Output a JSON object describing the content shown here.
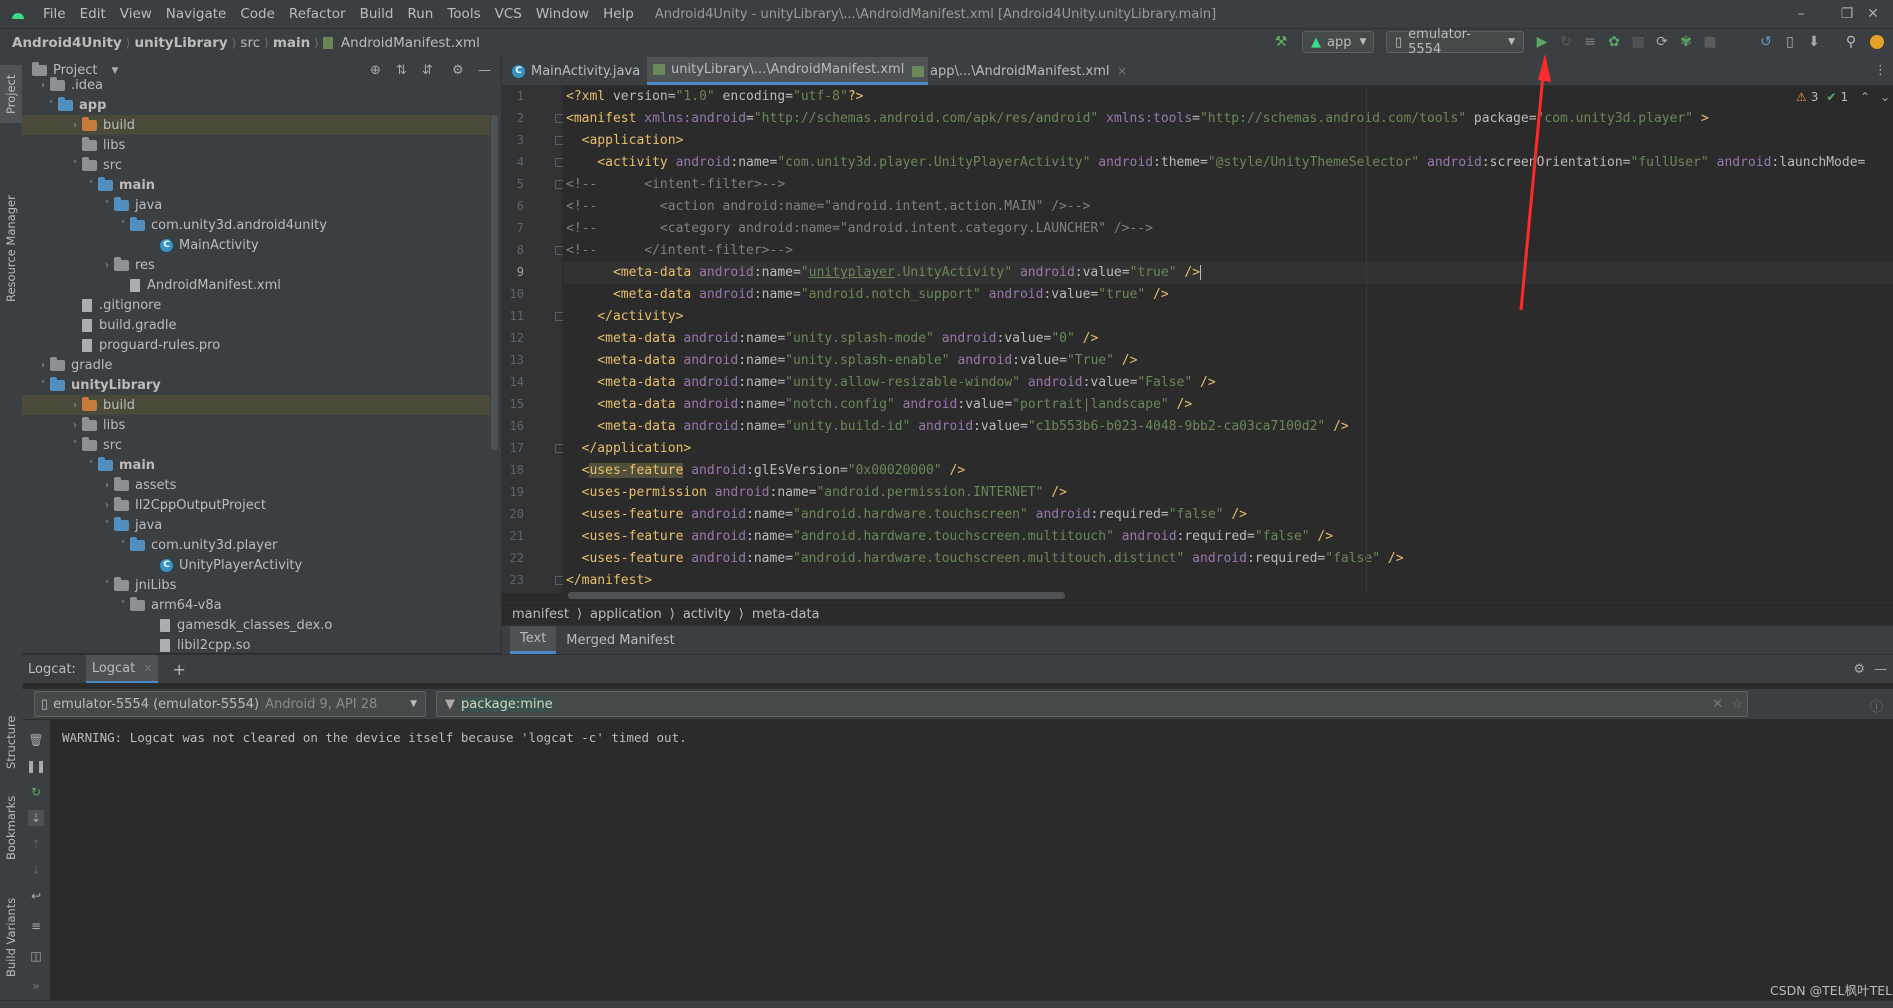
{
  "titlebar": {
    "menu": [
      "File",
      "Edit",
      "View",
      "Navigate",
      "Code",
      "Refactor",
      "Build",
      "Run",
      "Tools",
      "VCS",
      "Window",
      "Help"
    ],
    "title": "Android4Unity - unityLibrary\\...\\AndroidManifest.xml [Android4Unity.unityLibrary.main]"
  },
  "navbar": {
    "breadcrumbs": [
      "Android4Unity",
      "unityLibrary",
      "src",
      "main",
      "AndroidManifest.xml"
    ],
    "run_config": "app",
    "device": "emulator-5554"
  },
  "sidebar_left": {
    "project": "Project",
    "resource_manager": "Resource Manager",
    "structure": "Structure",
    "bookmarks": "Bookmarks",
    "build_variants": "Build Variants"
  },
  "project": {
    "header": "Project",
    "tree": [
      {
        "label": ".idea"
      },
      {
        "label": "app"
      },
      {
        "label": "build"
      },
      {
        "label": "libs"
      },
      {
        "label": "src"
      },
      {
        "label": "main"
      },
      {
        "label": "java"
      },
      {
        "label": "com.unity3d.android4unity"
      },
      {
        "label": "MainActivity"
      },
      {
        "label": "res"
      },
      {
        "label": "AndroidManifest.xml"
      },
      {
        "label": ".gitignore"
      },
      {
        "label": "build.gradle"
      },
      {
        "label": "proguard-rules.pro"
      },
      {
        "label": "gradle"
      },
      {
        "label": "unityLibrary"
      },
      {
        "label": "build"
      },
      {
        "label": "libs"
      },
      {
        "label": "src"
      },
      {
        "label": "main"
      },
      {
        "label": "assets"
      },
      {
        "label": "Il2CppOutputProject"
      },
      {
        "label": "java"
      },
      {
        "label": "com.unity3d.player"
      },
      {
        "label": "UnityPlayerActivity"
      },
      {
        "label": "jniLibs"
      },
      {
        "label": "arm64-v8a"
      },
      {
        "label": "gamesdk_classes_dex.o"
      },
      {
        "label": "libil2cpp.so"
      }
    ]
  },
  "editor": {
    "tabs": [
      "MainActivity.java",
      "unityLibrary\\...\\AndroidManifest.xml",
      "app\\...\\AndroidManifest.xml"
    ],
    "inspections": {
      "warnings": "3",
      "ok": "1"
    },
    "line_numbers": [
      "1",
      "2",
      "3",
      "4",
      "5",
      "6",
      "7",
      "8",
      "9",
      "10",
      "11",
      "12",
      "13",
      "14",
      "15",
      "16",
      "17",
      "18",
      "19",
      "20",
      "21",
      "22",
      "23"
    ],
    "breadcrumb": [
      "manifest",
      "application",
      "activity",
      "meta-data"
    ],
    "bottom_tabs": [
      "Text",
      "Merged Manifest"
    ]
  },
  "logcat": {
    "label": "Logcat:",
    "tab": "Logcat",
    "device": "emulator-5554 (emulator-5554)",
    "device_detail": "Android 9, API 28",
    "filter": "package:mine",
    "message": "WARNING: Logcat was not cleared on the device itself because 'logcat -c' timed out."
  },
  "watermark": "CSDN @TEL枫叶TEL",
  "colors": {
    "tag": "#e8bf6a",
    "value": "#6a8759",
    "namespace": "#9876aa",
    "comment": "#808080",
    "accent": "#4a88c7",
    "annotation": "#ff2a2a"
  }
}
